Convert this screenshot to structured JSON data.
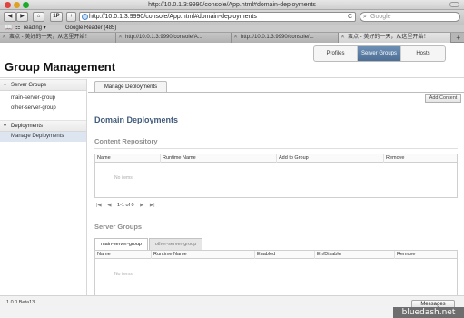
{
  "browser": {
    "window_title": "http://10.0.1.3:9990/console/App.html#domain-deployments",
    "url": "http://10.0.1.3:9990/console/App.html#domain-deployments",
    "search_placeholder": "Google",
    "back_label": "◀",
    "forward_label": "▶",
    "home_label": "⌂",
    "reading_list_label": "1P",
    "add_label": "+",
    "reload_label": "C",
    "bookmarks": {
      "reading": "reading ▾",
      "google_reader": "Google Reader (485)"
    },
    "tabs": [
      {
        "label": "蛮点 - 美好的一天，从这里开始！"
      },
      {
        "label": "http://10.0.1.3:9990/console/A..."
      },
      {
        "label": "http://10.0.1.3:9990/console/..."
      },
      {
        "label": "蛮点 - 美好的一天，从这里开始！"
      }
    ]
  },
  "app": {
    "title": "Group Management",
    "top_tabs": [
      {
        "label": "Profiles"
      },
      {
        "label": "Server Groups"
      },
      {
        "label": "Hosts"
      }
    ]
  },
  "sidebar": {
    "server_groups_header": "Server Groups",
    "server_groups": [
      {
        "label": "main-server-group"
      },
      {
        "label": "other-server-group"
      }
    ],
    "deployments_header": "Deployments",
    "deployments": [
      {
        "label": "Manage Deployments"
      }
    ]
  },
  "main": {
    "tab_label": "Manage Deployments",
    "add_content_label": "Add Content",
    "section_title": "Domain Deployments",
    "content_repository": {
      "title": "Content Repository",
      "columns": [
        "Name",
        "Runtime Name",
        "Add to Group",
        "Remove"
      ],
      "empty_text": "No items!",
      "pager_first": "|◀",
      "pager_prev": "◀",
      "pager_text": "1-1 of 0",
      "pager_next": "▶",
      "pager_last": "▶|"
    },
    "server_groups": {
      "title": "Server Groups",
      "tabs": [
        {
          "label": "main-server-group"
        },
        {
          "label": "other-server-group"
        }
      ],
      "columns": [
        "Name",
        "Runtime Name",
        "Enabled",
        "En/Disable",
        "Remove"
      ],
      "empty_text": "No items!"
    }
  },
  "footer": {
    "version": "1.0.0.Beta13",
    "messages_label": "Messages"
  },
  "watermark": "bluedash.net",
  "colors": {
    "accent": "#4d6f95",
    "section_title": "#3f5a7a",
    "selected_row": "#dde6f0"
  }
}
